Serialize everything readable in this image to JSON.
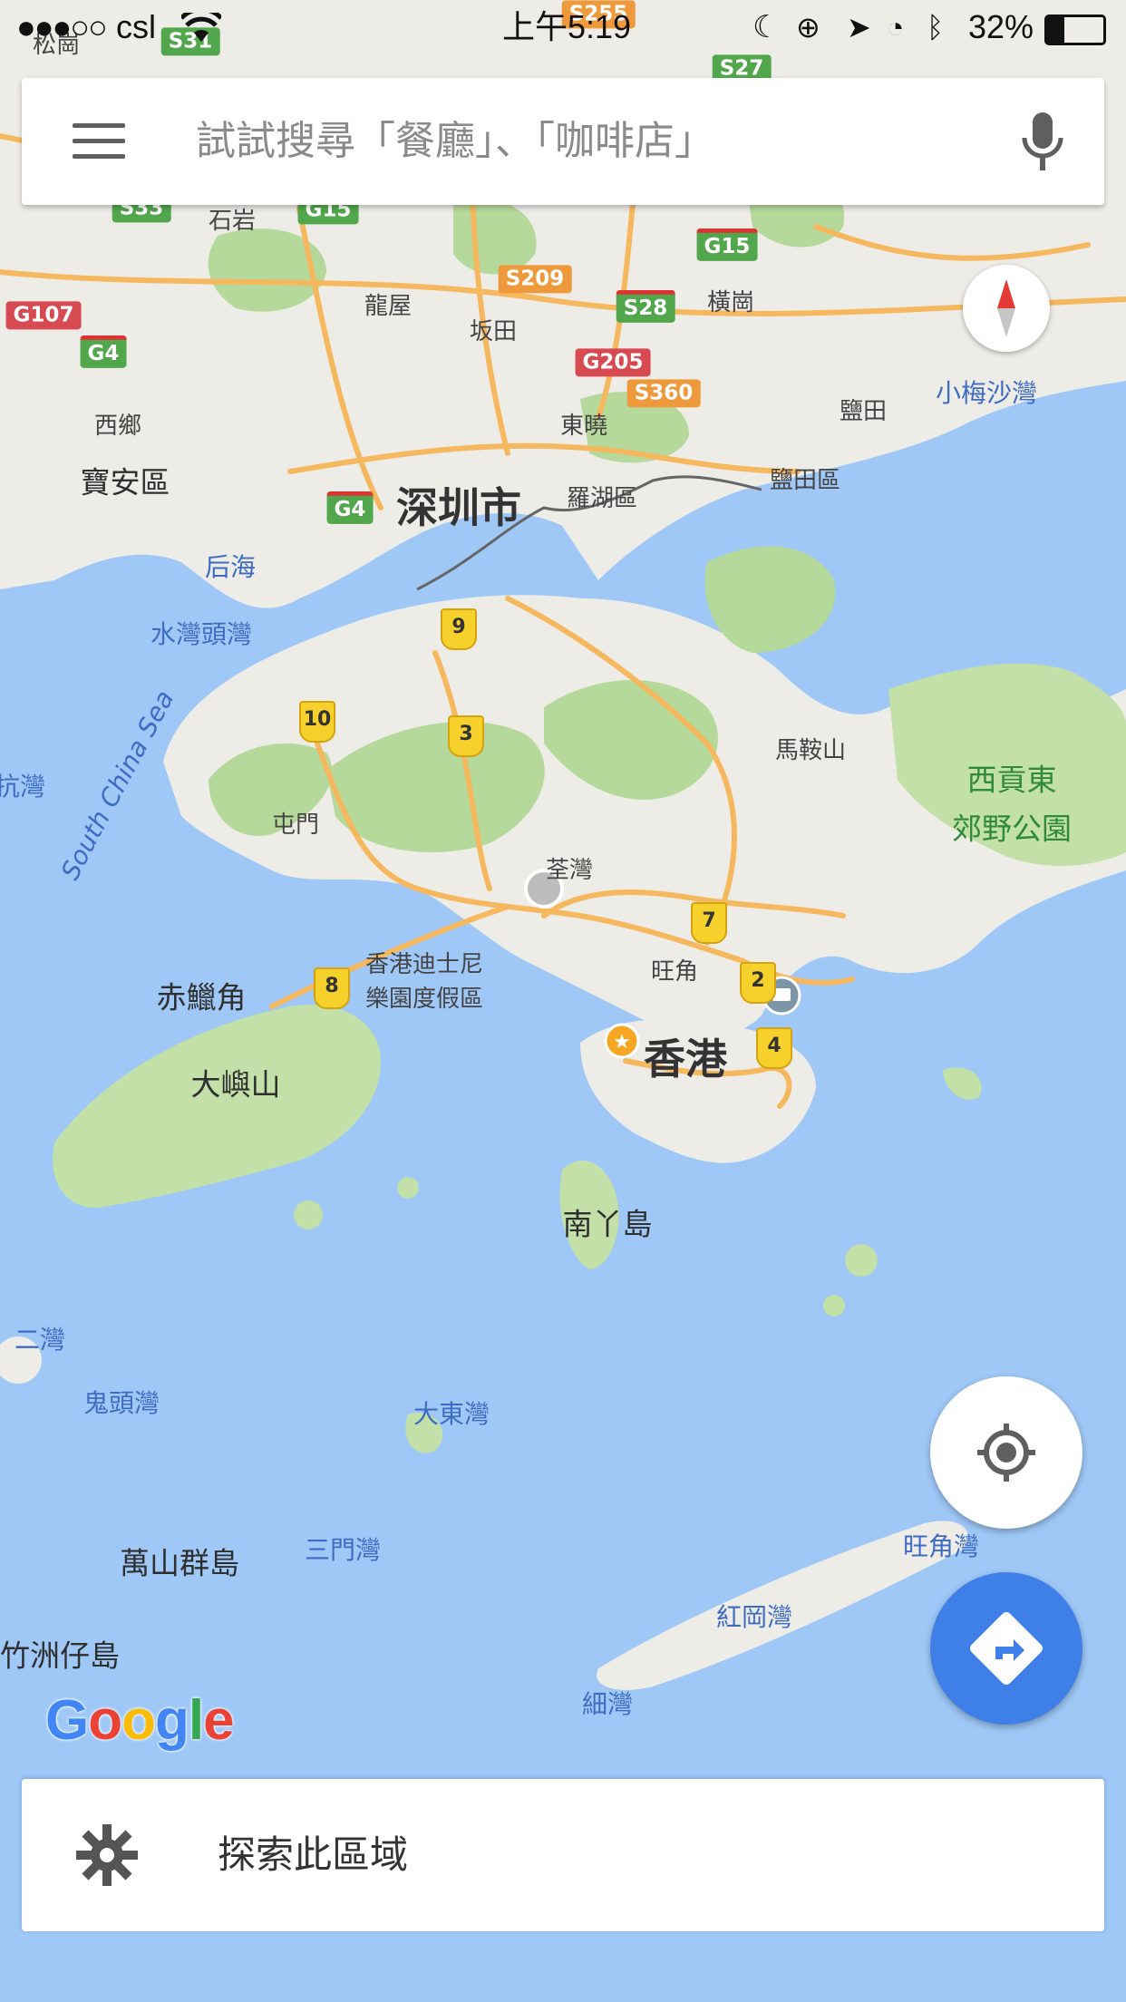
{
  "status_bar": {
    "carrier": "csl",
    "time": "上午5:19",
    "battery": "32%",
    "signal_bars": 3,
    "signal_total": 5
  },
  "search": {
    "placeholder": "試試搜尋「餐廳」、「咖啡店」"
  },
  "map": {
    "big_labels": [
      "深圳市",
      "香港"
    ],
    "labels": [
      "松崗",
      "石岩",
      "龍屋",
      "坂田",
      "橫崗",
      "西鄉",
      "寶安區",
      "東曉",
      "羅湖區",
      "鹽田",
      "鹽田區",
      "屯門",
      "荃灣",
      "旺角",
      "馬鞍山",
      "赤鱲角",
      "大嶼山",
      "南丫島",
      "萬山群島",
      "竹洲仔島",
      "香港迪士尼",
      "樂園度假區"
    ],
    "water_labels": [
      "后海",
      "水灣頭灣",
      "小梅沙灣",
      "大東灣",
      "鬼頭灣",
      "三門灣",
      "紅岡灣",
      "細灣",
      "旺角灣",
      "二灣",
      "抗灣"
    ],
    "sea_label": "South China Sea",
    "park_label_1": "西貢東",
    "park_label_2": "郊野公園",
    "highway_shields": [
      "S31",
      "S255",
      "S27",
      "S33",
      "G15",
      "G15",
      "S209",
      "S28",
      "G107",
      "G4",
      "G205",
      "S360",
      "G4"
    ],
    "route_markers": [
      "9",
      "10",
      "3",
      "7",
      "8",
      "2",
      "4"
    ]
  },
  "brand": {
    "logo_text": "Google",
    "logo_colors": [
      "#4285F4",
      "#EA4335",
      "#FBBC05",
      "#4285F4",
      "#34A853",
      "#EA4335"
    ]
  },
  "explore": {
    "label": "探索此區域",
    "icon": "gear-icon"
  },
  "buttons": {
    "locate_icon": "my-location-icon",
    "directions_icon": "directions-icon",
    "compass_icon": "compass-icon",
    "menu_icon": "hamburger-menu-icon",
    "mic_icon": "microphone-icon"
  },
  "colors": {
    "water": "#9fc8f7",
    "land": "#f0eee9",
    "park": "#b5d99a",
    "road": "#f5b85e",
    "accent": "#3f7fe8"
  }
}
